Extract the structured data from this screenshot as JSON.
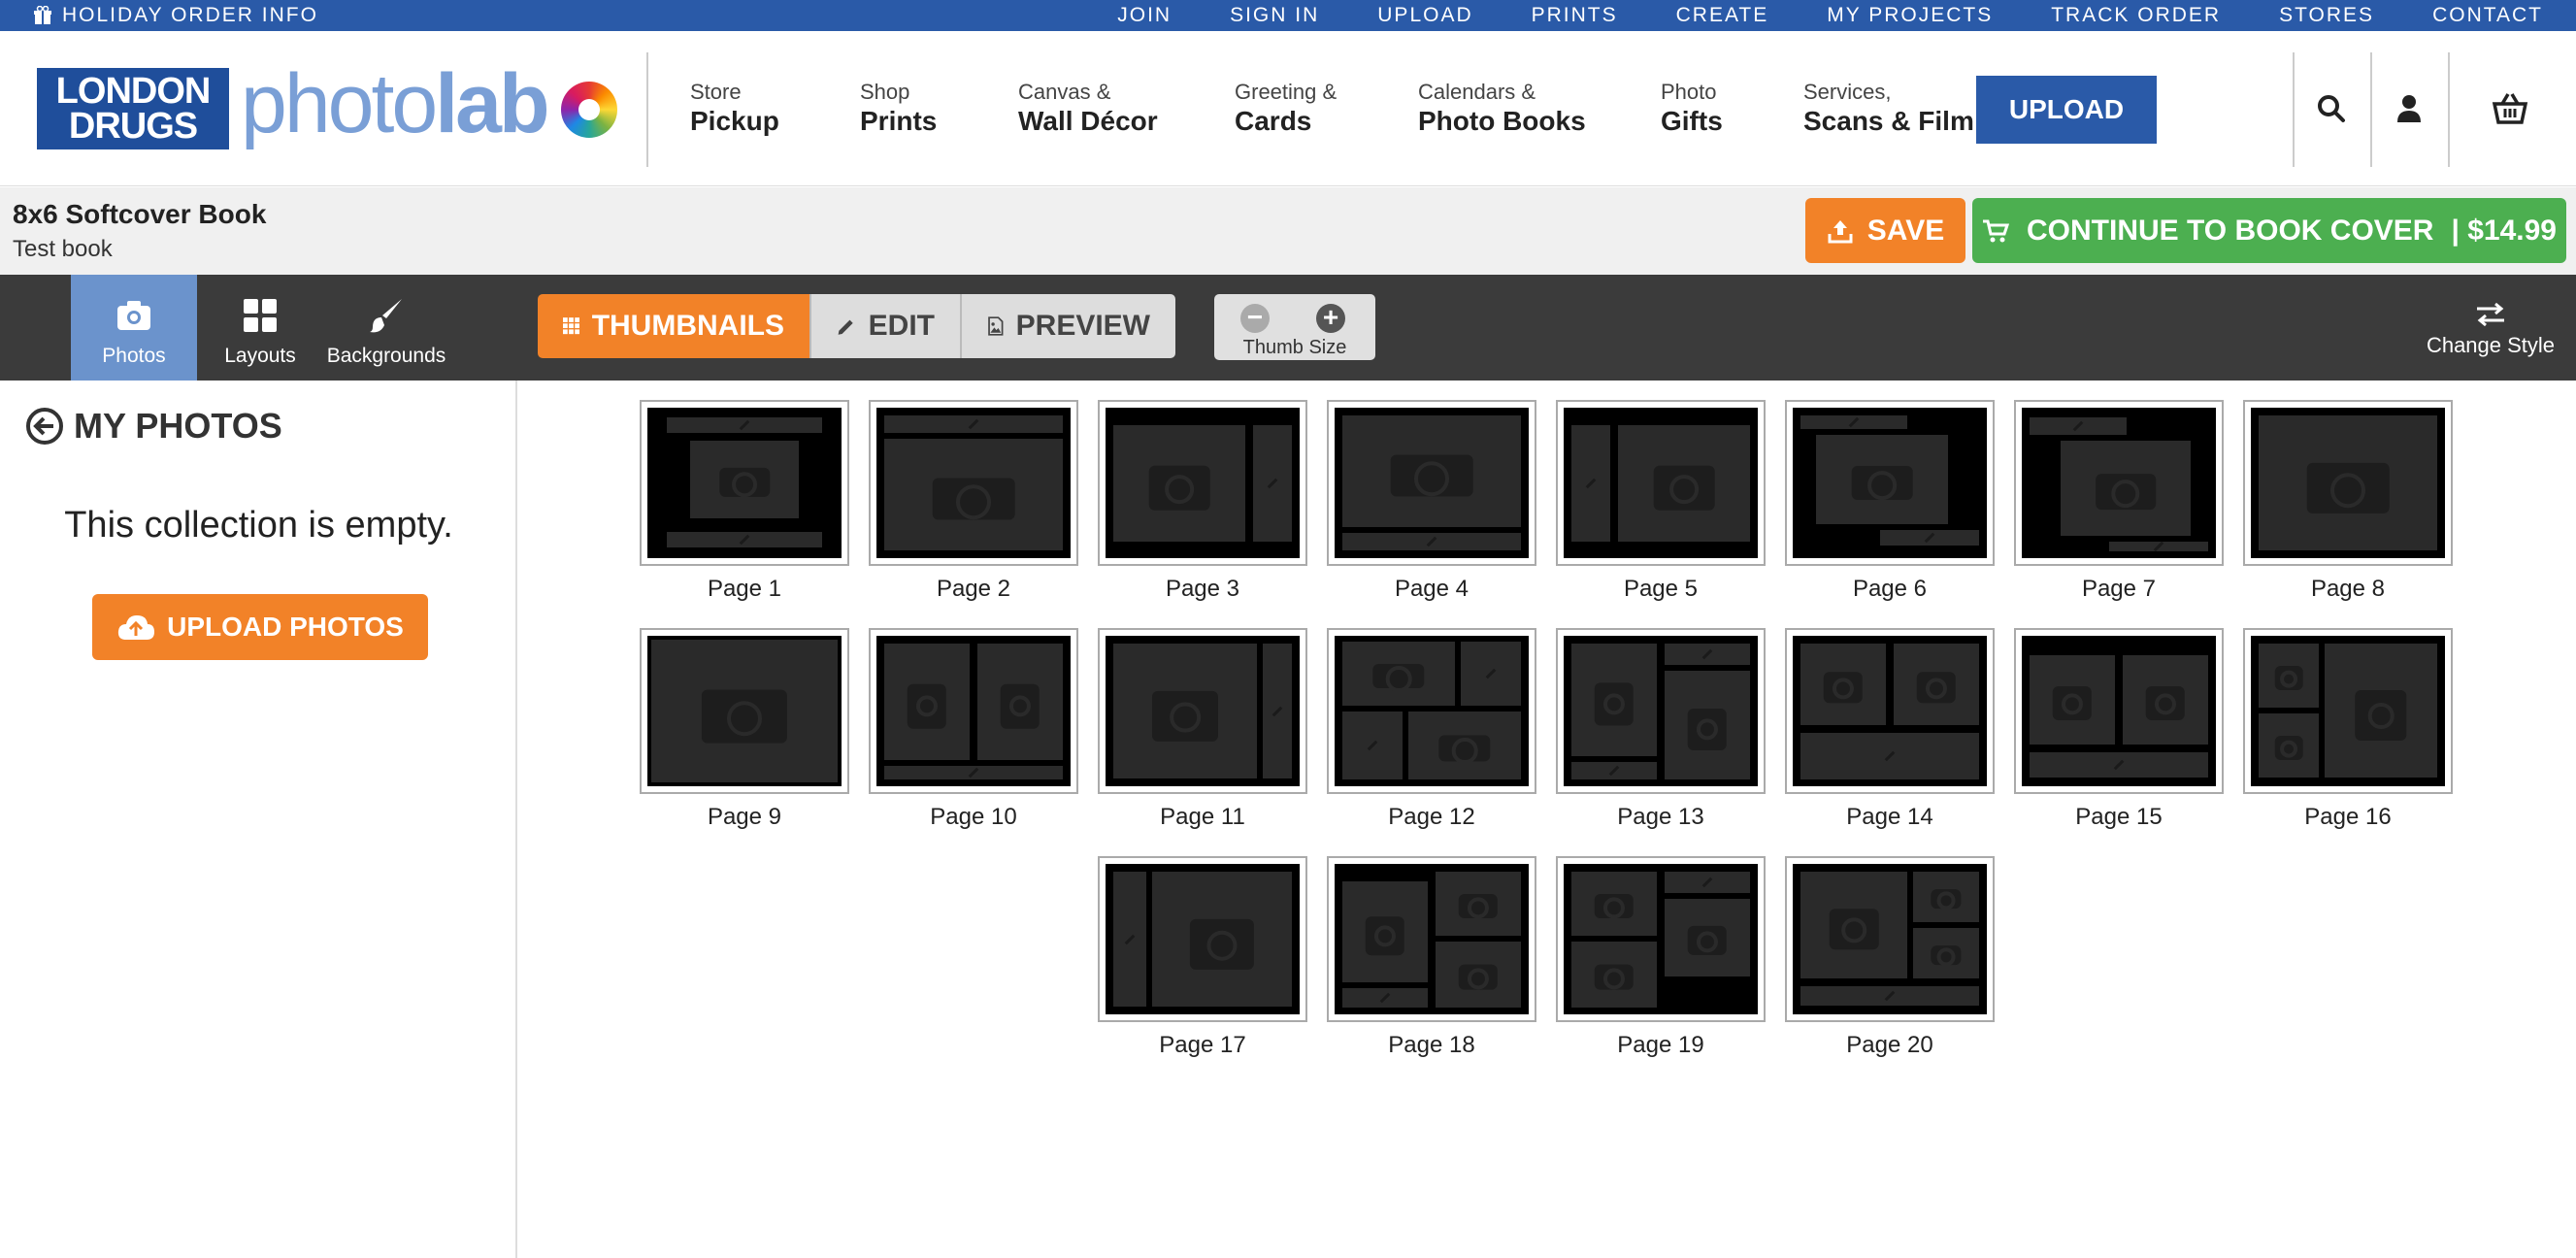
{
  "topbar": {
    "holiday": "HOLIDAY ORDER INFO",
    "links": [
      "JOIN",
      "SIGN IN",
      "UPLOAD",
      "PRINTS",
      "CREATE",
      "MY PROJECTS",
      "TRACK ORDER",
      "STORES",
      "CONTACT"
    ]
  },
  "header": {
    "logo_box": "LONDON DRUGS",
    "logo_word_light": "photo",
    "logo_word_bold": "lab",
    "nav": [
      {
        "top": "Store",
        "bottom": "Pickup"
      },
      {
        "top": "Shop",
        "bottom": "Prints"
      },
      {
        "top": "Canvas &",
        "bottom": "Wall Décor"
      },
      {
        "top": "Greeting &",
        "bottom": "Cards"
      },
      {
        "top": "Calendars &",
        "bottom": "Photo Books"
      },
      {
        "top": "Photo",
        "bottom": "Gifts"
      },
      {
        "top": "Services,",
        "bottom": "Scans & Film"
      }
    ],
    "upload_label": "UPLOAD",
    "icons": [
      "search-icon",
      "user-icon",
      "basket-icon"
    ]
  },
  "project": {
    "title": "8x6 Softcover Book",
    "subtitle": "Test book",
    "save_label": "SAVE",
    "continue_label": "CONTINUE TO BOOK COVER",
    "price": "| $14.99",
    "colors": {
      "orange": "#f28228",
      "green": "#4caf50",
      "blue": "#2a5aa8"
    }
  },
  "toolbar": {
    "tabs": [
      "Photos",
      "Layouts",
      "Backgrounds"
    ],
    "active_tab": "Photos",
    "views": [
      "THUMBNAILS",
      "EDIT",
      "PREVIEW"
    ],
    "active_view": "THUMBNAILS",
    "thumb_size_label": "Thumb Size",
    "change_style_label": "Change Style"
  },
  "sidebar": {
    "heading": "MY PHOTOS",
    "empty_message": "This collection is empty.",
    "upload_photos_label": "UPLOAD PHOTOS"
  },
  "pages": [
    "Page 1",
    "Page 2",
    "Page 3",
    "Page 4",
    "Page 5",
    "Page 6",
    "Page 7",
    "Page 8",
    "Page 9",
    "Page 10",
    "Page 11",
    "Page 12",
    "Page 13",
    "Page 14",
    "Page 15",
    "Page 16",
    "Page 17",
    "Page 18",
    "Page 19",
    "Page 20"
  ]
}
